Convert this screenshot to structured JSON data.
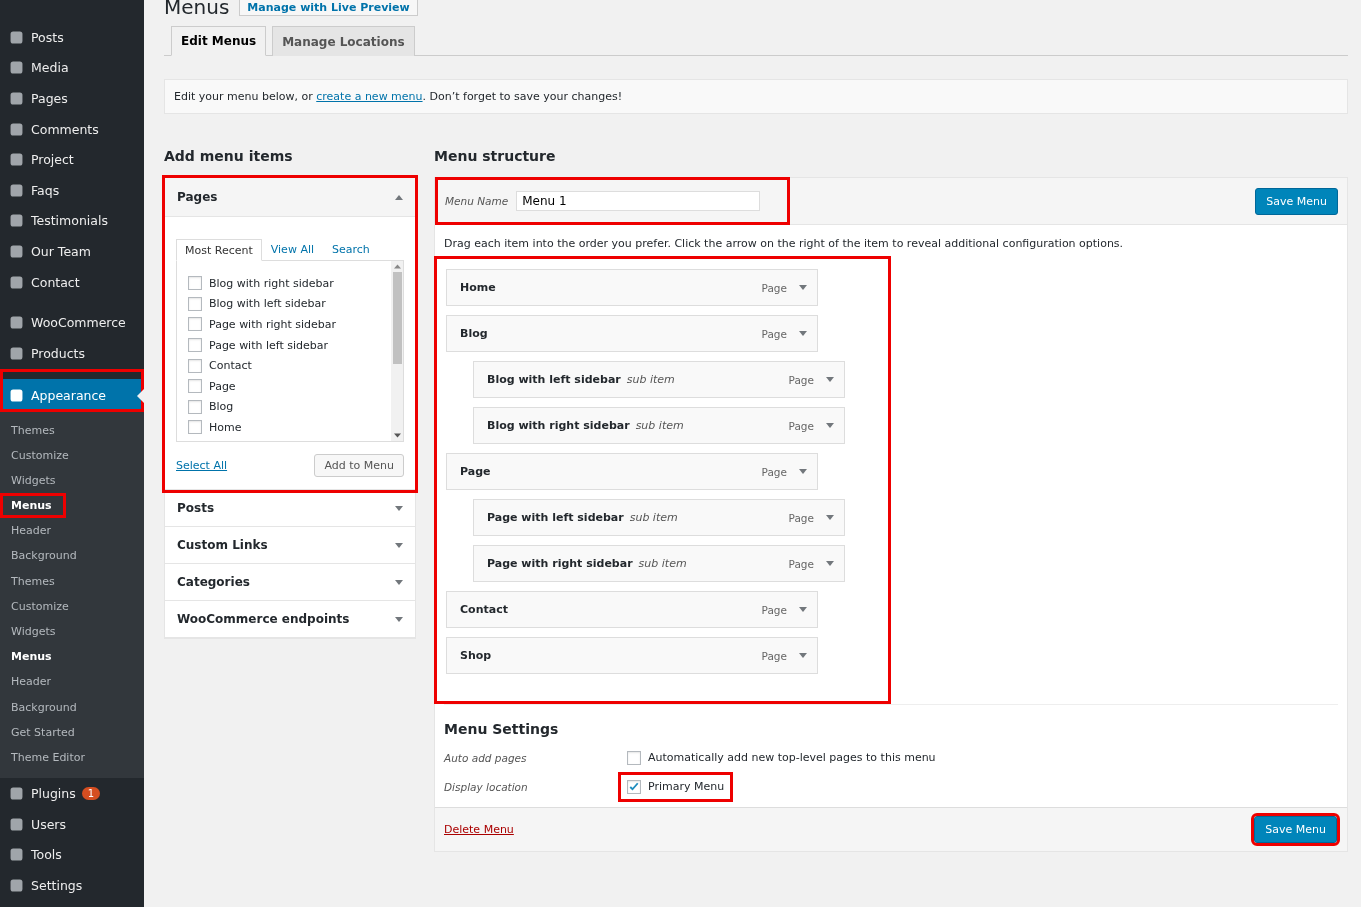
{
  "sidebar": {
    "items": [
      {
        "label": "Posts",
        "selected": false,
        "highlighted": false
      },
      {
        "label": "Media",
        "selected": false,
        "highlighted": false
      },
      {
        "label": "Pages",
        "selected": false,
        "highlighted": false
      },
      {
        "label": "Comments",
        "selected": false,
        "highlighted": false
      },
      {
        "label": "Project",
        "selected": false,
        "highlighted": false
      },
      {
        "label": "Faqs",
        "selected": false,
        "highlighted": false
      },
      {
        "label": "Testimonials",
        "selected": false,
        "highlighted": false
      },
      {
        "label": "Our Team",
        "selected": false,
        "highlighted": false
      },
      {
        "label": "Contact",
        "selected": false,
        "highlighted": false
      },
      {
        "label": "WooCommerce",
        "selected": false,
        "highlighted": false,
        "group_start": true
      },
      {
        "label": "Products",
        "selected": false,
        "highlighted": false
      },
      {
        "label": "Appearance",
        "selected": true,
        "highlighted": true,
        "group_start": true,
        "children": [
          {
            "label": "Themes",
            "selected": false,
            "highlighted": false
          },
          {
            "label": "Customize",
            "selected": false,
            "highlighted": false
          },
          {
            "label": "Widgets",
            "selected": false,
            "highlighted": false
          },
          {
            "label": "Menus",
            "selected": true,
            "highlighted": true
          },
          {
            "label": "Header",
            "selected": false,
            "highlighted": false
          },
          {
            "label": "Background",
            "selected": false,
            "highlighted": false
          },
          {
            "label": "Themes",
            "selected": false,
            "highlighted": false
          },
          {
            "label": "Customize",
            "selected": false,
            "highlighted": false
          },
          {
            "label": "Widgets",
            "selected": false,
            "highlighted": false
          },
          {
            "label": "Menus",
            "selected": true,
            "highlighted": false
          },
          {
            "label": "Header",
            "selected": false,
            "highlighted": false
          },
          {
            "label": "Background",
            "selected": false,
            "highlighted": false
          },
          {
            "label": "Get Started",
            "selected": false,
            "highlighted": false
          },
          {
            "label": "Theme Editor",
            "selected": false,
            "highlighted": false
          }
        ]
      },
      {
        "label": "Plugins",
        "selected": false,
        "highlighted": false,
        "badge": "1"
      },
      {
        "label": "Users",
        "selected": false,
        "highlighted": false
      },
      {
        "label": "Tools",
        "selected": false,
        "highlighted": false
      },
      {
        "label": "Settings",
        "selected": false,
        "highlighted": false
      }
    ]
  },
  "page": {
    "title": "Menus",
    "live_preview_button": "Manage with Live Preview"
  },
  "tabs": [
    {
      "label": "Edit Menus",
      "selected": true
    },
    {
      "label": "Manage Locations",
      "selected": false
    }
  ],
  "notice": {
    "before": "Edit your menu below, or ",
    "link": "create a new menu",
    "after": ". Don’t forget to save your changes!"
  },
  "add_items": {
    "heading": "Add menu items",
    "panels": [
      {
        "title": "Pages",
        "expanded": true,
        "highlighted": true,
        "tabs": [
          {
            "label": "Most Recent",
            "selected": true
          },
          {
            "label": "View All",
            "selected": false
          },
          {
            "label": "Search",
            "selected": false
          }
        ],
        "items": [
          {
            "label": "Blog with right sidebar",
            "checked": false
          },
          {
            "label": "Blog with left sidebar",
            "checked": false
          },
          {
            "label": "Page with right sidebar",
            "checked": false
          },
          {
            "label": "Page with left sidebar",
            "checked": false
          },
          {
            "label": "Contact",
            "checked": false
          },
          {
            "label": "Page",
            "checked": false
          },
          {
            "label": "Blog",
            "checked": false
          },
          {
            "label": "Home",
            "checked": false
          }
        ],
        "select_all": "Select All",
        "add_button": "Add to Menu"
      },
      {
        "title": "Posts",
        "expanded": false,
        "highlighted": false
      },
      {
        "title": "Custom Links",
        "expanded": false,
        "highlighted": false
      },
      {
        "title": "Categories",
        "expanded": false,
        "highlighted": false
      },
      {
        "title": "WooCommerce endpoints",
        "expanded": false,
        "highlighted": false
      }
    ]
  },
  "structure": {
    "heading": "Menu structure",
    "name_label": "Menu Name",
    "name_value": "Menu 1",
    "name_highlighted": true,
    "save_button": "Save Menu",
    "instructions": "Drag each item into the order you prefer. Click the arrow on the right of the item to reveal additional configuration options.",
    "items_highlighted": true,
    "items": [
      {
        "title": "Home",
        "type": "Page"
      },
      {
        "title": "Blog",
        "type": "Page",
        "children": [
          {
            "title": "Blog with left sidebar",
            "note": "sub item",
            "type": "Page"
          },
          {
            "title": "Blog with right sidebar",
            "note": "sub item",
            "type": "Page"
          }
        ]
      },
      {
        "title": "Page",
        "type": "Page",
        "children": [
          {
            "title": "Page with left sidebar",
            "note": "sub item",
            "type": "Page"
          },
          {
            "title": "Page with right sidebar",
            "note": "sub item",
            "type": "Page"
          }
        ]
      },
      {
        "title": "Contact",
        "type": "Page"
      },
      {
        "title": "Shop",
        "type": "Page"
      }
    ],
    "settings": {
      "heading": "Menu Settings",
      "rows": [
        {
          "label": "Auto add pages",
          "option": "Automatically add new top-level pages to this menu",
          "checked": false,
          "highlighted": false
        },
        {
          "label": "Display location",
          "option": "Primary Menu",
          "checked": true,
          "highlighted": true
        }
      ]
    },
    "delete_link": "Delete Menu",
    "footer_save_button": "Save Menu",
    "footer_save_highlighted": true
  }
}
